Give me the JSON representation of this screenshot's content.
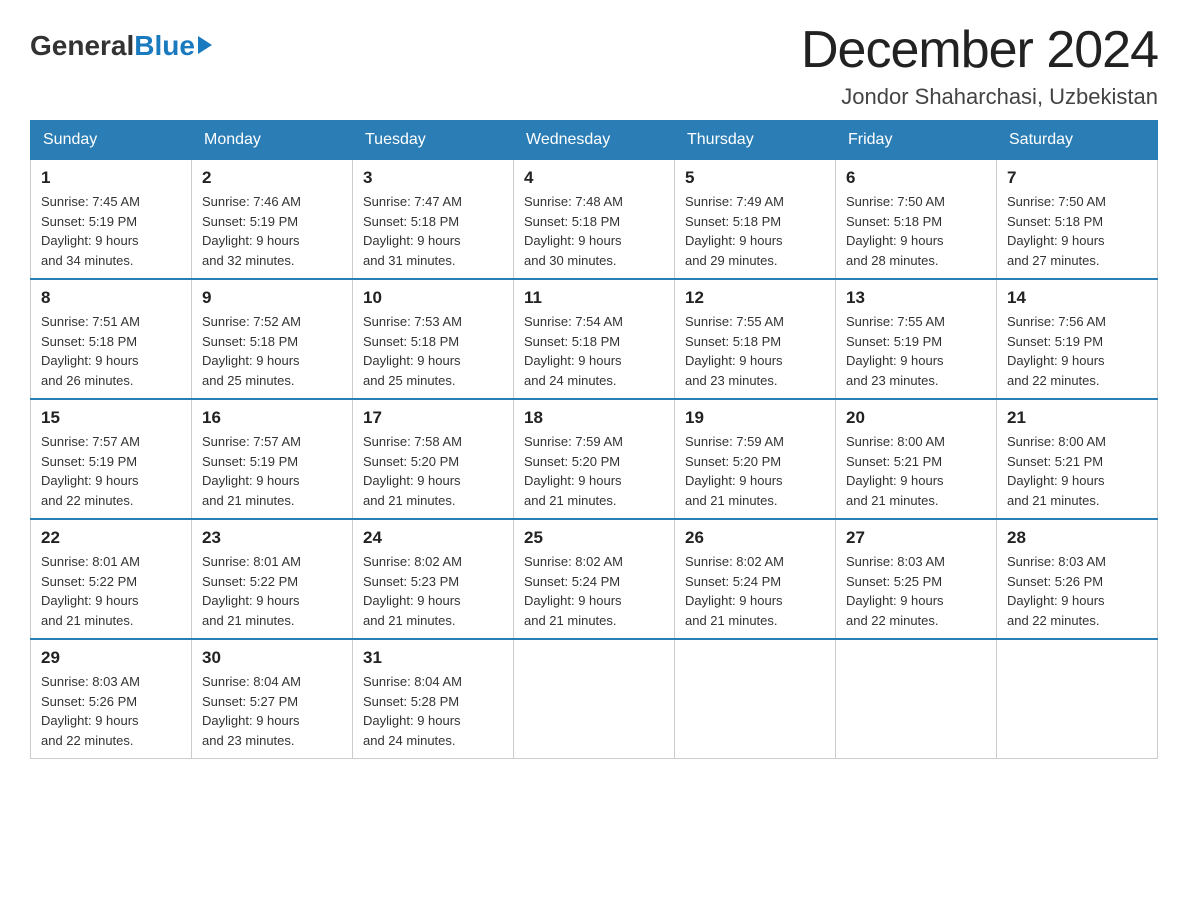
{
  "logo": {
    "general": "General",
    "blue": "Blue"
  },
  "header": {
    "month": "December 2024",
    "location": "Jondor Shaharchasi, Uzbekistan"
  },
  "days_of_week": [
    "Sunday",
    "Monday",
    "Tuesday",
    "Wednesday",
    "Thursday",
    "Friday",
    "Saturday"
  ],
  "weeks": [
    [
      {
        "day": "1",
        "sunrise": "7:45 AM",
        "sunset": "5:19 PM",
        "daylight": "9 hours and 34 minutes."
      },
      {
        "day": "2",
        "sunrise": "7:46 AM",
        "sunset": "5:19 PM",
        "daylight": "9 hours and 32 minutes."
      },
      {
        "day": "3",
        "sunrise": "7:47 AM",
        "sunset": "5:18 PM",
        "daylight": "9 hours and 31 minutes."
      },
      {
        "day": "4",
        "sunrise": "7:48 AM",
        "sunset": "5:18 PM",
        "daylight": "9 hours and 30 minutes."
      },
      {
        "day": "5",
        "sunrise": "7:49 AM",
        "sunset": "5:18 PM",
        "daylight": "9 hours and 29 minutes."
      },
      {
        "day": "6",
        "sunrise": "7:50 AM",
        "sunset": "5:18 PM",
        "daylight": "9 hours and 28 minutes."
      },
      {
        "day": "7",
        "sunrise": "7:50 AM",
        "sunset": "5:18 PM",
        "daylight": "9 hours and 27 minutes."
      }
    ],
    [
      {
        "day": "8",
        "sunrise": "7:51 AM",
        "sunset": "5:18 PM",
        "daylight": "9 hours and 26 minutes."
      },
      {
        "day": "9",
        "sunrise": "7:52 AM",
        "sunset": "5:18 PM",
        "daylight": "9 hours and 25 minutes."
      },
      {
        "day": "10",
        "sunrise": "7:53 AM",
        "sunset": "5:18 PM",
        "daylight": "9 hours and 25 minutes."
      },
      {
        "day": "11",
        "sunrise": "7:54 AM",
        "sunset": "5:18 PM",
        "daylight": "9 hours and 24 minutes."
      },
      {
        "day": "12",
        "sunrise": "7:55 AM",
        "sunset": "5:18 PM",
        "daylight": "9 hours and 23 minutes."
      },
      {
        "day": "13",
        "sunrise": "7:55 AM",
        "sunset": "5:19 PM",
        "daylight": "9 hours and 23 minutes."
      },
      {
        "day": "14",
        "sunrise": "7:56 AM",
        "sunset": "5:19 PM",
        "daylight": "9 hours and 22 minutes."
      }
    ],
    [
      {
        "day": "15",
        "sunrise": "7:57 AM",
        "sunset": "5:19 PM",
        "daylight": "9 hours and 22 minutes."
      },
      {
        "day": "16",
        "sunrise": "7:57 AM",
        "sunset": "5:19 PM",
        "daylight": "9 hours and 21 minutes."
      },
      {
        "day": "17",
        "sunrise": "7:58 AM",
        "sunset": "5:20 PM",
        "daylight": "9 hours and 21 minutes."
      },
      {
        "day": "18",
        "sunrise": "7:59 AM",
        "sunset": "5:20 PM",
        "daylight": "9 hours and 21 minutes."
      },
      {
        "day": "19",
        "sunrise": "7:59 AM",
        "sunset": "5:20 PM",
        "daylight": "9 hours and 21 minutes."
      },
      {
        "day": "20",
        "sunrise": "8:00 AM",
        "sunset": "5:21 PM",
        "daylight": "9 hours and 21 minutes."
      },
      {
        "day": "21",
        "sunrise": "8:00 AM",
        "sunset": "5:21 PM",
        "daylight": "9 hours and 21 minutes."
      }
    ],
    [
      {
        "day": "22",
        "sunrise": "8:01 AM",
        "sunset": "5:22 PM",
        "daylight": "9 hours and 21 minutes."
      },
      {
        "day": "23",
        "sunrise": "8:01 AM",
        "sunset": "5:22 PM",
        "daylight": "9 hours and 21 minutes."
      },
      {
        "day": "24",
        "sunrise": "8:02 AM",
        "sunset": "5:23 PM",
        "daylight": "9 hours and 21 minutes."
      },
      {
        "day": "25",
        "sunrise": "8:02 AM",
        "sunset": "5:24 PM",
        "daylight": "9 hours and 21 minutes."
      },
      {
        "day": "26",
        "sunrise": "8:02 AM",
        "sunset": "5:24 PM",
        "daylight": "9 hours and 21 minutes."
      },
      {
        "day": "27",
        "sunrise": "8:03 AM",
        "sunset": "5:25 PM",
        "daylight": "9 hours and 22 minutes."
      },
      {
        "day": "28",
        "sunrise": "8:03 AM",
        "sunset": "5:26 PM",
        "daylight": "9 hours and 22 minutes."
      }
    ],
    [
      {
        "day": "29",
        "sunrise": "8:03 AM",
        "sunset": "5:26 PM",
        "daylight": "9 hours and 22 minutes."
      },
      {
        "day": "30",
        "sunrise": "8:04 AM",
        "sunset": "5:27 PM",
        "daylight": "9 hours and 23 minutes."
      },
      {
        "day": "31",
        "sunrise": "8:04 AM",
        "sunset": "5:28 PM",
        "daylight": "9 hours and 24 minutes."
      },
      null,
      null,
      null,
      null
    ]
  ],
  "labels": {
    "sunrise": "Sunrise:",
    "sunset": "Sunset:",
    "daylight": "Daylight:"
  }
}
